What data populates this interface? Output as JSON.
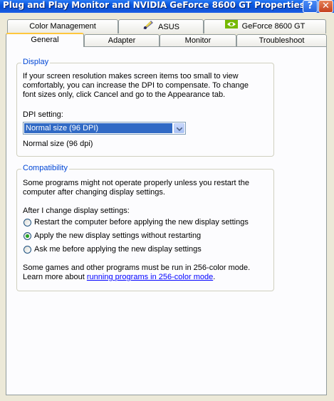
{
  "window": {
    "title": "Plug and Play Monitor and NVIDIA GeForce 8600 GT Properties"
  },
  "titlebar_buttons": {
    "help": "?",
    "close": "✕"
  },
  "tabs_back": [
    {
      "label": "Color Management",
      "icon": null
    },
    {
      "label": "ASUS",
      "icon": "asus-utility-icon"
    },
    {
      "label": "GeForce 8600 GT",
      "icon": "nvidia-logo-icon"
    }
  ],
  "tabs_front": [
    {
      "label": "General",
      "active": true
    },
    {
      "label": "Adapter"
    },
    {
      "label": "Monitor"
    },
    {
      "label": "Troubleshoot"
    }
  ],
  "display": {
    "group_title": "Display",
    "description": [
      "If your screen resolution makes screen items too small to view",
      "comfortably, you can increase the DPI to compensate.  To change",
      "font sizes only, click Cancel and go to the Appearance tab."
    ],
    "dpi_label": "DPI setting:",
    "dpi_selected": "Normal size (96 DPI)",
    "dpi_note": "Normal size (96 dpi)"
  },
  "compatibility": {
    "group_title": "Compatibility",
    "description": [
      "Some programs might not operate properly unless you restart the",
      "computer after changing display settings."
    ],
    "after_label": "After I change display settings:",
    "options": [
      {
        "label": "Restart the computer before applying the new display settings",
        "selected": false
      },
      {
        "label": "Apply the new display settings without restarting",
        "selected": true
      },
      {
        "label": "Ask me before applying the new display settings",
        "selected": false
      }
    ],
    "games_text": "Some games and other programs must be run in 256-color mode.",
    "learn_prefix": "Learn more about ",
    "learn_link": "running programs in 256-color mode",
    "learn_suffix": "."
  },
  "colors": {
    "accent": "#0046d5",
    "selection": "#316ac5",
    "tab_highlight": "#ffc73c",
    "radio_dot": "#21a121"
  }
}
